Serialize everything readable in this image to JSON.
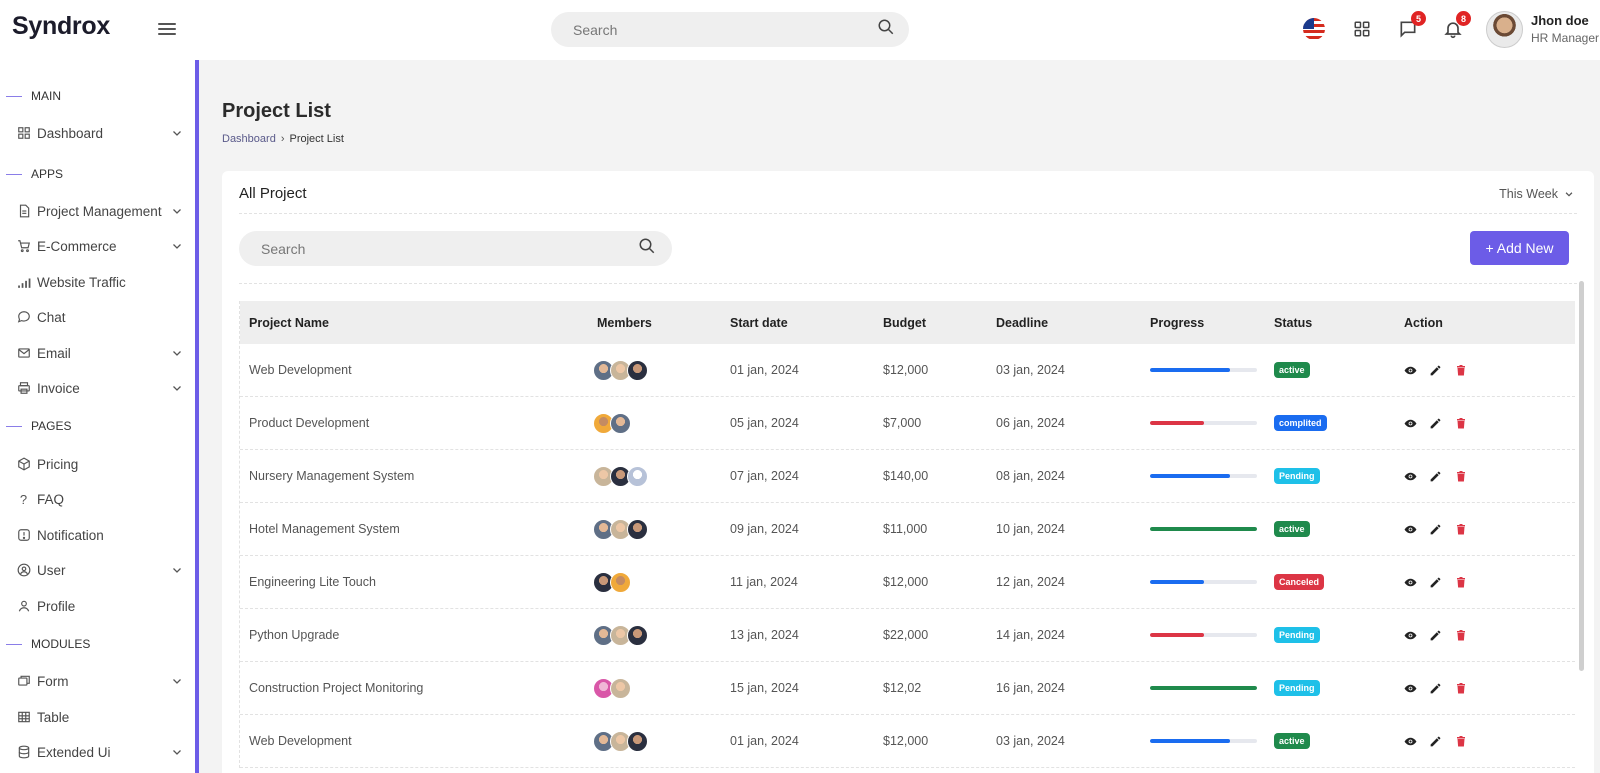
{
  "app": {
    "logo": "Syndrox"
  },
  "header": {
    "search_placeholder": "Search",
    "messages_badge": "5",
    "notifications_badge": "8",
    "user_name": "Jhon doe",
    "user_role": "HR Manager"
  },
  "sidebar": {
    "sections": {
      "main": "MAIN",
      "apps": "APPS",
      "pages": "PAGES",
      "modules": "MODULES"
    },
    "items": {
      "dashboard": "Dashboard",
      "project_management": "Project Management",
      "ecommerce": "E-Commerce",
      "website_traffic": "Website Traffic",
      "chat": "Chat",
      "email": "Email",
      "invoice": "Invoice",
      "pricing": "Pricing",
      "faq": "FAQ",
      "notification": "Notification",
      "user": "User",
      "profile": "Profile",
      "form": "Form",
      "table": "Table",
      "extended_ui": "Extended Ui"
    }
  },
  "page": {
    "title": "Project List",
    "breadcrumb": {
      "home": "Dashboard",
      "current": "Project List"
    }
  },
  "card": {
    "title": "All Project",
    "filter": "This Week",
    "search_placeholder": "Search",
    "add_button": "+ Add New"
  },
  "table": {
    "headers": {
      "name": "Project Name",
      "members": "Members",
      "start": "Start date",
      "budget": "Budget",
      "deadline": "Deadline",
      "progress": "Progress",
      "status": "Status",
      "action": "Action"
    },
    "rows": [
      {
        "name": "Web Development",
        "members": [
          "av-m1",
          "av-f1",
          "av-m2"
        ],
        "start": "01 jan, 2024",
        "budget": "$12,000",
        "deadline": "03 jan, 2024",
        "progress": 0.75,
        "progress_color": "#1a6cf0",
        "status": "active",
        "status_color": "#1f8a4c"
      },
      {
        "name": "Product Development",
        "members": [
          "av-y1",
          "av-m1"
        ],
        "start": "05 jan, 2024",
        "budget": "$7,000",
        "deadline": "06 jan, 2024",
        "progress": 0.5,
        "progress_color": "#dc3545",
        "status": "complited",
        "status_color": "#1a6cf0"
      },
      {
        "name": "Nursery Management System",
        "members": [
          "av-f1",
          "av-m2",
          "av-g1"
        ],
        "start": "07 jan, 2024",
        "budget": "$140,00",
        "deadline": "08 jan, 2024",
        "progress": 0.75,
        "progress_color": "#1a6cf0",
        "status": "Pending",
        "status_color": "#1ec0e8"
      },
      {
        "name": "Hotel Management System",
        "members": [
          "av-m1",
          "av-f1",
          "av-m2"
        ],
        "start": "09 jan, 2024",
        "budget": "$11,000",
        "deadline": "10 jan, 2024",
        "progress": 1.0,
        "progress_color": "#1f8a4c",
        "status": "active",
        "status_color": "#1f8a4c"
      },
      {
        "name": "Engineering Lite Touch",
        "members": [
          "av-m2",
          "av-y1"
        ],
        "start": "11 jan, 2024",
        "budget": "$12,000",
        "deadline": "12 jan, 2024",
        "progress": 0.5,
        "progress_color": "#1a6cf0",
        "status": "Canceled",
        "status_color": "#dc3545"
      },
      {
        "name": "Python Upgrade",
        "members": [
          "av-m1",
          "av-f1",
          "av-m2"
        ],
        "start": "13 jan, 2024",
        "budget": "$22,000",
        "deadline": "14 jan, 2024",
        "progress": 0.5,
        "progress_color": "#dc3545",
        "status": "Pending",
        "status_color": "#1ec0e8"
      },
      {
        "name": "Construction Project Monitoring",
        "members": [
          "av-p1",
          "av-f1"
        ],
        "start": "15 jan, 2024",
        "budget": "$12,02",
        "deadline": "16 jan, 2024",
        "progress": 1.0,
        "progress_color": "#1f8a4c",
        "status": "Pending",
        "status_color": "#1ec0e8"
      },
      {
        "name": "Web Development",
        "members": [
          "av-m1",
          "av-f1",
          "av-m2"
        ],
        "start": "01 jan, 2024",
        "budget": "$12,000",
        "deadline": "03 jan, 2024",
        "progress": 0.75,
        "progress_color": "#1a6cf0",
        "status": "active",
        "status_color": "#1f8a4c"
      }
    ]
  }
}
